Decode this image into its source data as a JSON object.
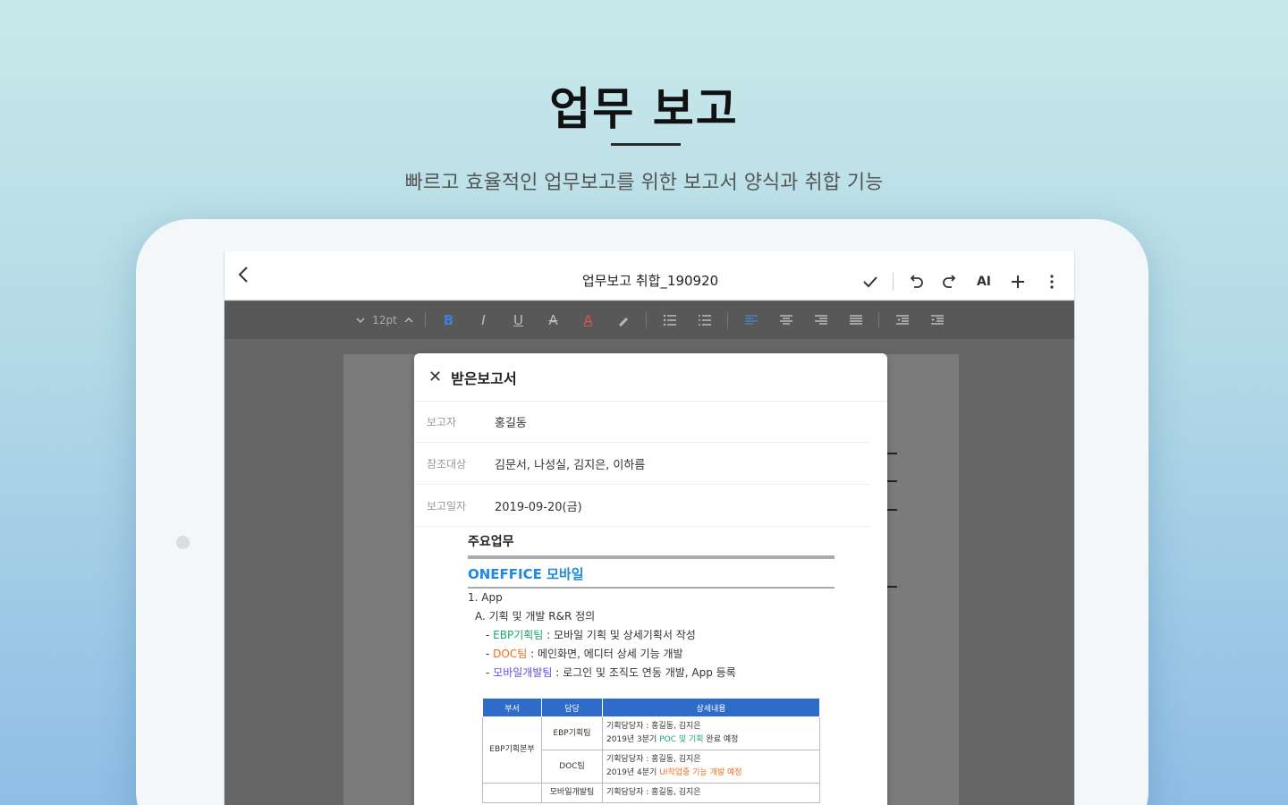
{
  "hero": {
    "title": "업무 보고",
    "subtitle": "빠르고 효율적인 업무보고를 위한 보고서 양식과 취합 기능"
  },
  "app_bar": {
    "document_title": "업무보고 취합_190920",
    "ai_label": "AI"
  },
  "format_bar": {
    "font_size": "12pt",
    "bold": "B",
    "italic": "I",
    "underline": "U",
    "strikethrough": "A",
    "font_color": "A"
  },
  "panel": {
    "title": "받은보고서",
    "rows": [
      {
        "label": "보고자",
        "value": "홍길동"
      },
      {
        "label": "참조대상",
        "value": "김문서, 나성실, 김지은, 이하름"
      },
      {
        "label": "보고일자",
        "value": "2019-09-20(금)"
      }
    ]
  },
  "document": {
    "section_title": "주요업무",
    "project_title": "ONEFFICE 모바일",
    "item_1": "1. App",
    "item_a": "A. 기획 및 개발 R&R 정의",
    "bullets": [
      {
        "prefix": "- ",
        "team": "EBP기획팀",
        "text": " : 모바일 기획 및 상세기획서 작성"
      },
      {
        "prefix": "- ",
        "team": "DOC팀",
        "text": " : 메인화면, 에디터 상세 기능 개발"
      },
      {
        "prefix": "- ",
        "team": "모바일개발팀",
        "text": " : 로그인 및 조직도 연동 개발, App 등록"
      }
    ],
    "table": {
      "headers": [
        "부서",
        "담당",
        "상세내용"
      ],
      "group": "EBP기획본부",
      "rows": [
        {
          "team": "EBP기획팀",
          "line1": "기획담당자 : 홍길동, 김지은",
          "line2_pre": "2019년 3분기 ",
          "line2_hl": "POC 및 기획",
          "line2_post": " 완료 예정"
        },
        {
          "team": "DOC팀",
          "line1": "기획담당자 : 홍길동, 김지은",
          "line2_pre": "2019년 4분기 ",
          "line2_hl": "UI작업중 기능 개발 예정",
          "line2_post": ""
        },
        {
          "team": "모바일개발팀",
          "line1": "기획담당자 : 홍길동, 김지은",
          "line2_pre": "",
          "line2_hl": "",
          "line2_post": ""
        }
      ]
    }
  },
  "colors": {
    "accent_blue": "#1e88e5",
    "table_header": "#2f6bc8",
    "green": "#1da86b",
    "orange": "#f26b1d",
    "purple": "#6a4be0"
  }
}
